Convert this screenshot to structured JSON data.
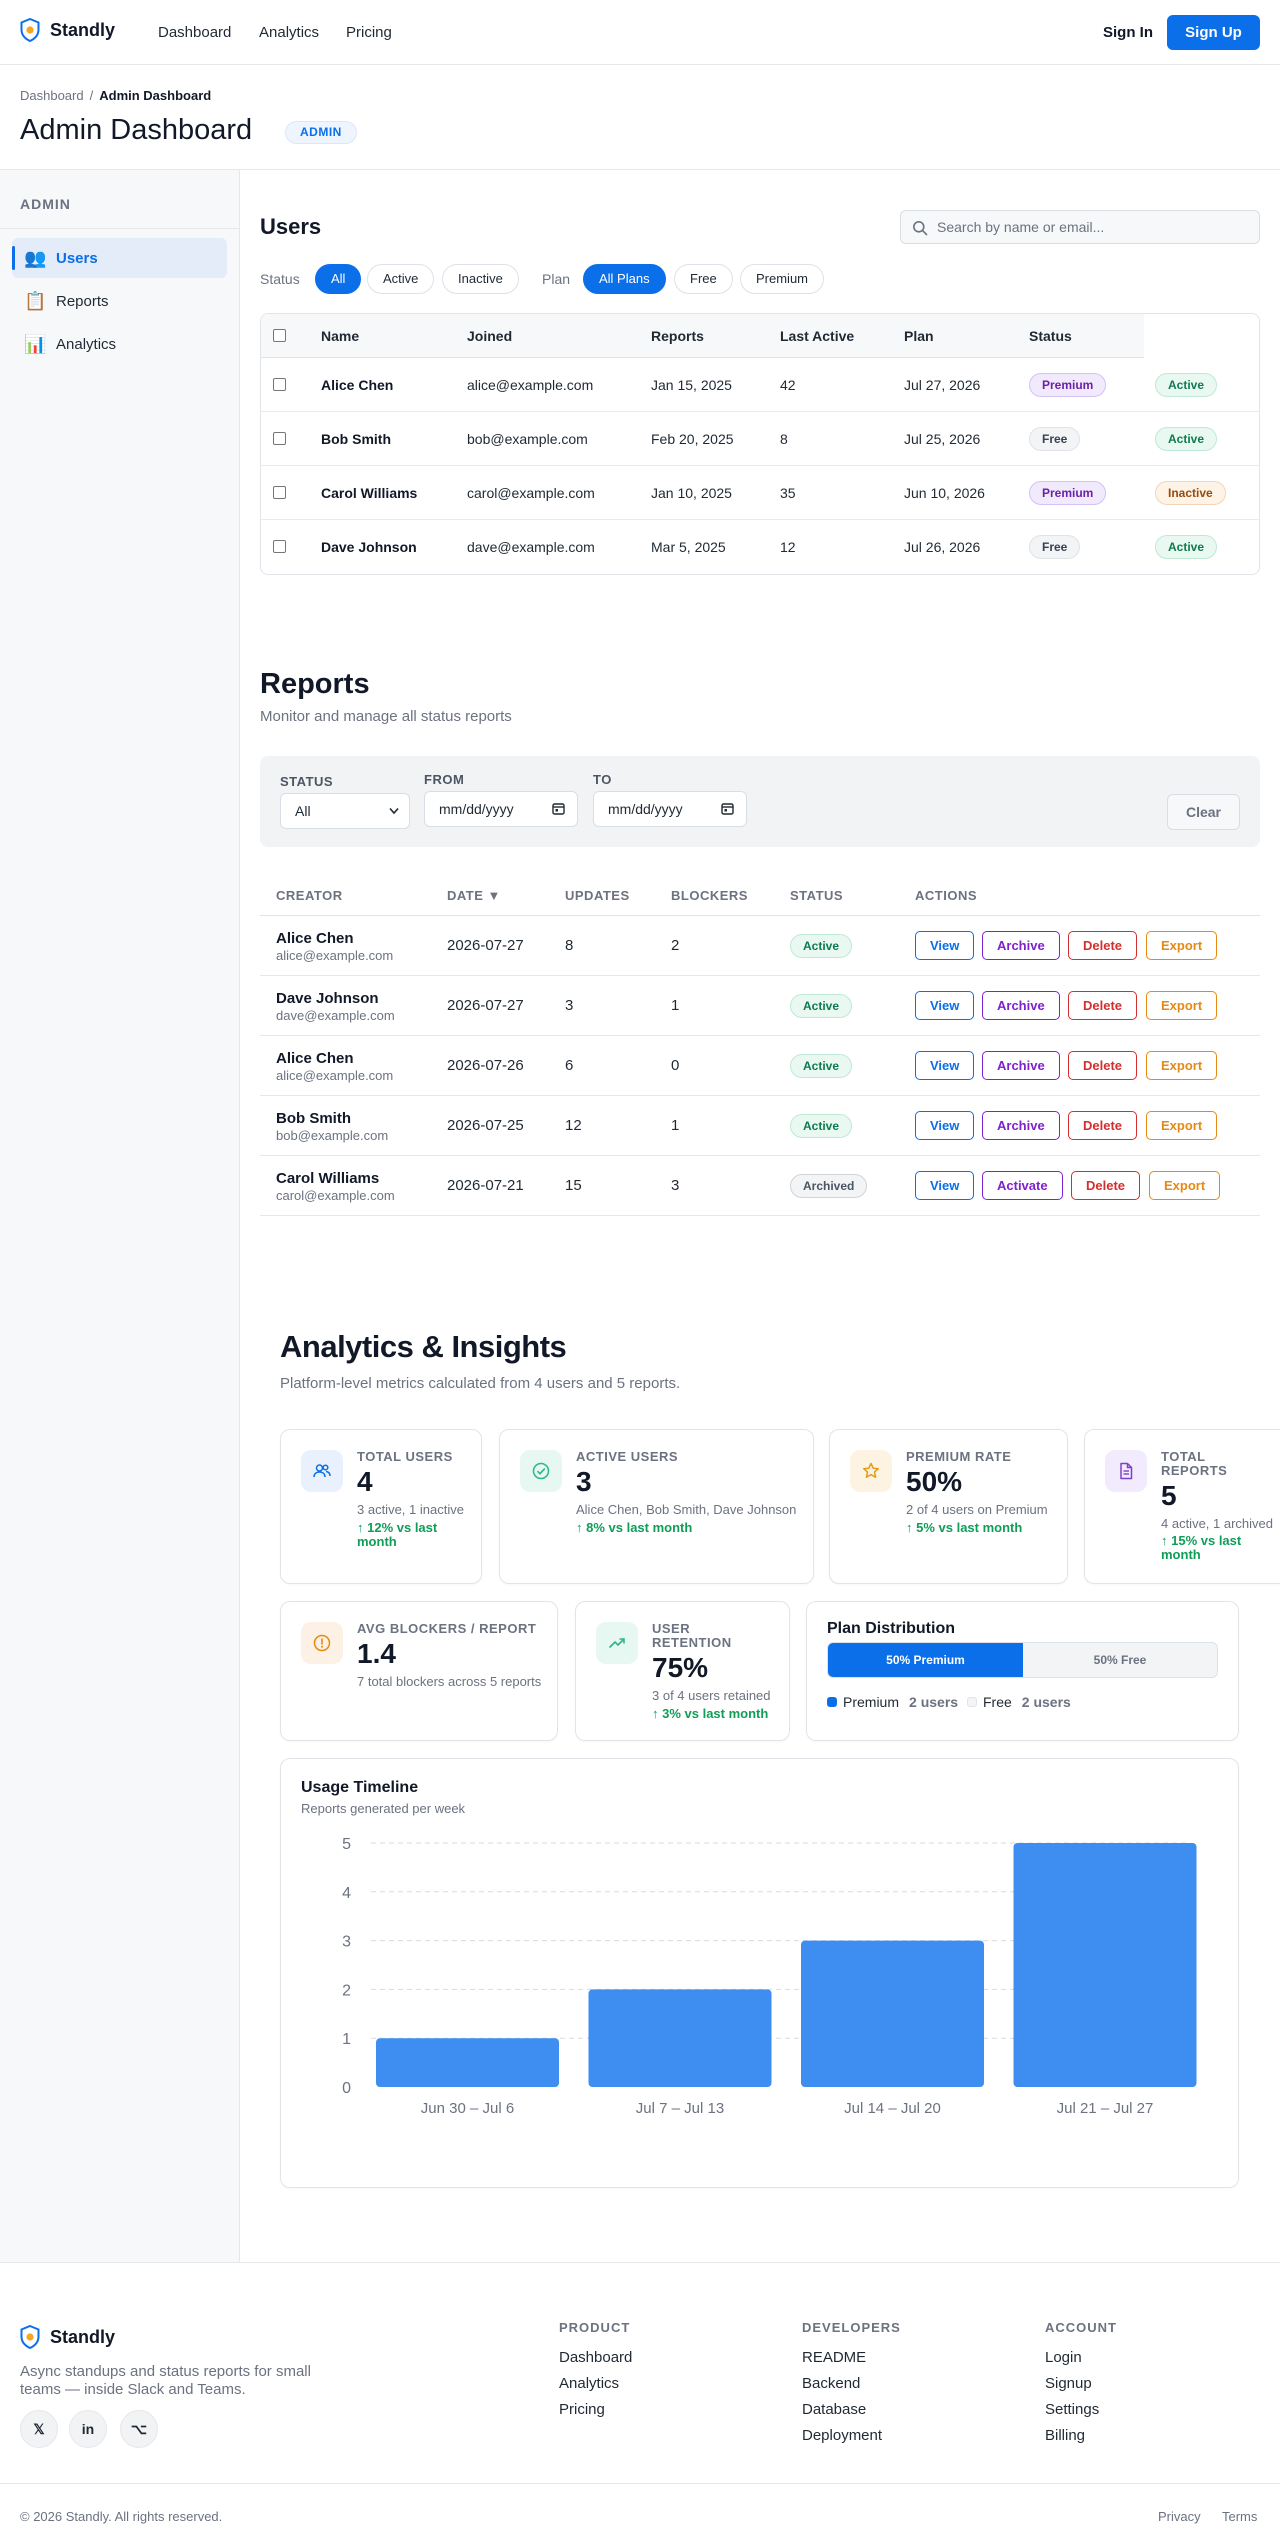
{
  "nav": {
    "brand": "Standly",
    "links": [
      "Dashboard",
      "Analytics",
      "Pricing"
    ],
    "sign_in": "Sign In",
    "sign_up": "Sign Up"
  },
  "page": {
    "breadcrumb": [
      "Dashboard",
      "/",
      "Admin Dashboard"
    ],
    "title": "Admin Dashboard",
    "badge": "ADMIN"
  },
  "sidebar": {
    "heading": "ADMIN",
    "items": [
      {
        "label": "Users",
        "icon": "users-icon",
        "glyph": "👥"
      },
      {
        "label": "Reports",
        "icon": "clipboard-icon",
        "glyph": "📋"
      },
      {
        "label": "Analytics",
        "icon": "bar-chart-icon",
        "glyph": "📊"
      }
    ]
  },
  "users": {
    "title": "Users",
    "search_placeholder": "Search by name or email...",
    "status_label": "Status",
    "status_filters": [
      "All",
      "Active",
      "Inactive"
    ],
    "plan_label": "Plan",
    "plan_filters": [
      "All Plans",
      "Free",
      "Premium"
    ],
    "columns": [
      "Name",
      "Joined",
      "Reports",
      "Last Active",
      "Plan",
      "Status"
    ],
    "rows": [
      {
        "name": "Alice Chen",
        "email": "alice@example.com",
        "joined": "Jan 15, 2025",
        "reports": "42",
        "last_active": "Jul 27, 2026",
        "plan": "Premium",
        "status": "Active"
      },
      {
        "name": "Bob Smith",
        "email": "bob@example.com",
        "joined": "Feb 20, 2025",
        "reports": "8",
        "last_active": "Jul 25, 2026",
        "plan": "Free",
        "status": "Active"
      },
      {
        "name": "Carol Williams",
        "email": "carol@example.com",
        "joined": "Jan 10, 2025",
        "reports": "35",
        "last_active": "Jun 10, 2026",
        "plan": "Premium",
        "status": "Inactive"
      },
      {
        "name": "Dave Johnson",
        "email": "dave@example.com",
        "joined": "Mar 5, 2025",
        "reports": "12",
        "last_active": "Jul 26, 2026",
        "plan": "Free",
        "status": "Active"
      }
    ]
  },
  "reports": {
    "title": "Reports",
    "subtitle": "Monitor and manage all status reports",
    "filters": {
      "status_label": "STATUS",
      "status_value": "All",
      "from_label": "FROM",
      "from_value": "mm/dd/yyyy",
      "to_label": "TO",
      "to_value": "mm/dd/yyyy",
      "clear": "Clear"
    },
    "columns": [
      "CREATOR",
      "DATE ▼",
      "UPDATES",
      "BLOCKERS",
      "STATUS",
      "ACTIONS"
    ],
    "rows": [
      {
        "name": "Alice Chen",
        "email": "alice@example.com",
        "date": "2026-07-27",
        "updates": "8",
        "blockers": "2",
        "status": "Active",
        "actions": [
          "View",
          "Archive",
          "Delete",
          "Export"
        ]
      },
      {
        "name": "Dave Johnson",
        "email": "dave@example.com",
        "date": "2026-07-27",
        "updates": "3",
        "blockers": "1",
        "status": "Active",
        "actions": [
          "View",
          "Archive",
          "Delete",
          "Export"
        ]
      },
      {
        "name": "Alice Chen",
        "email": "alice@example.com",
        "date": "2026-07-26",
        "updates": "6",
        "blockers": "0",
        "status": "Active",
        "actions": [
          "View",
          "Archive",
          "Delete",
          "Export"
        ]
      },
      {
        "name": "Bob Smith",
        "email": "bob@example.com",
        "date": "2026-07-25",
        "updates": "12",
        "blockers": "1",
        "status": "Active",
        "actions": [
          "View",
          "Archive",
          "Delete",
          "Export"
        ]
      },
      {
        "name": "Carol Williams",
        "email": "carol@example.com",
        "date": "2026-07-21",
        "updates": "15",
        "blockers": "3",
        "status": "Archived",
        "actions": [
          "View",
          "Activate",
          "Delete",
          "Export"
        ]
      }
    ]
  },
  "analytics": {
    "title": "Analytics & Insights",
    "subtitle": "Platform-level metrics calculated from 4 users and 5 reports.",
    "cards": [
      {
        "label": "TOTAL USERS",
        "value": "4",
        "desc": "3 active, 1 inactive",
        "trend": "↑ 12% vs last month"
      },
      {
        "label": "ACTIVE USERS",
        "value": "3",
        "desc": "Alice Chen, Bob Smith, Dave Johnson",
        "trend": "↑ 8% vs last month"
      },
      {
        "label": "PREMIUM RATE",
        "value": "50%",
        "desc": "2 of 4 users on Premium",
        "trend": "↑ 5% vs last month"
      },
      {
        "label": "TOTAL REPORTS",
        "value": "5",
        "desc": "4 active, 1 archived",
        "trend": "↑ 15% vs last month"
      },
      {
        "label": "AVG BLOCKERS / REPORT",
        "value": "1.4",
        "desc": "7 total blockers across 5 reports",
        "trend": ""
      },
      {
        "label": "USER RETENTION",
        "value": "75%",
        "desc": "3 of 4 users retained",
        "trend": "↑ 3% vs last month"
      }
    ],
    "plan_distribution": {
      "title": "Plan Distribution",
      "premium_fraction": 0.5,
      "premium_label": "50% Premium",
      "free_label": "50% Free",
      "legend": [
        {
          "name": "Premium",
          "count": "2 users"
        },
        {
          "name": "Free",
          "count": "2 users"
        }
      ]
    },
    "colors": {
      "accent": "#0a6fe8",
      "bar": "#3d8ef0",
      "trend_up": "#0f9d58"
    }
  },
  "chart_data": {
    "type": "bar",
    "title": "Usage Timeline",
    "subtitle": "Reports generated per week",
    "categories": [
      "Jun 30 – Jul 6",
      "Jul 7 – Jul 13",
      "Jul 14 – Jul 20",
      "Jul 21 – Jul 27"
    ],
    "values": [
      1,
      2,
      3,
      5
    ],
    "yticks": [
      "0",
      "1",
      "2",
      "3",
      "4",
      "5"
    ],
    "ylim": [
      0,
      5
    ],
    "grid": true
  },
  "footer": {
    "brand": "Standly",
    "desc": "Async standups and status reports for small teams — inside Slack and Teams.",
    "social": [
      "𝕏",
      "in",
      "⌥"
    ],
    "columns": [
      {
        "heading": "PRODUCT",
        "links": [
          "Dashboard",
          "Analytics",
          "Pricing"
        ]
      },
      {
        "heading": "DEVELOPERS",
        "links": [
          "README",
          "Backend",
          "Database",
          "Deployment"
        ]
      },
      {
        "heading": "ACCOUNT",
        "links": [
          "Login",
          "Signup",
          "Settings",
          "Billing"
        ]
      }
    ],
    "copyright": "© 2026 Standly. All rights reserved.",
    "privacy": "Privacy",
    "terms": "Terms"
  }
}
